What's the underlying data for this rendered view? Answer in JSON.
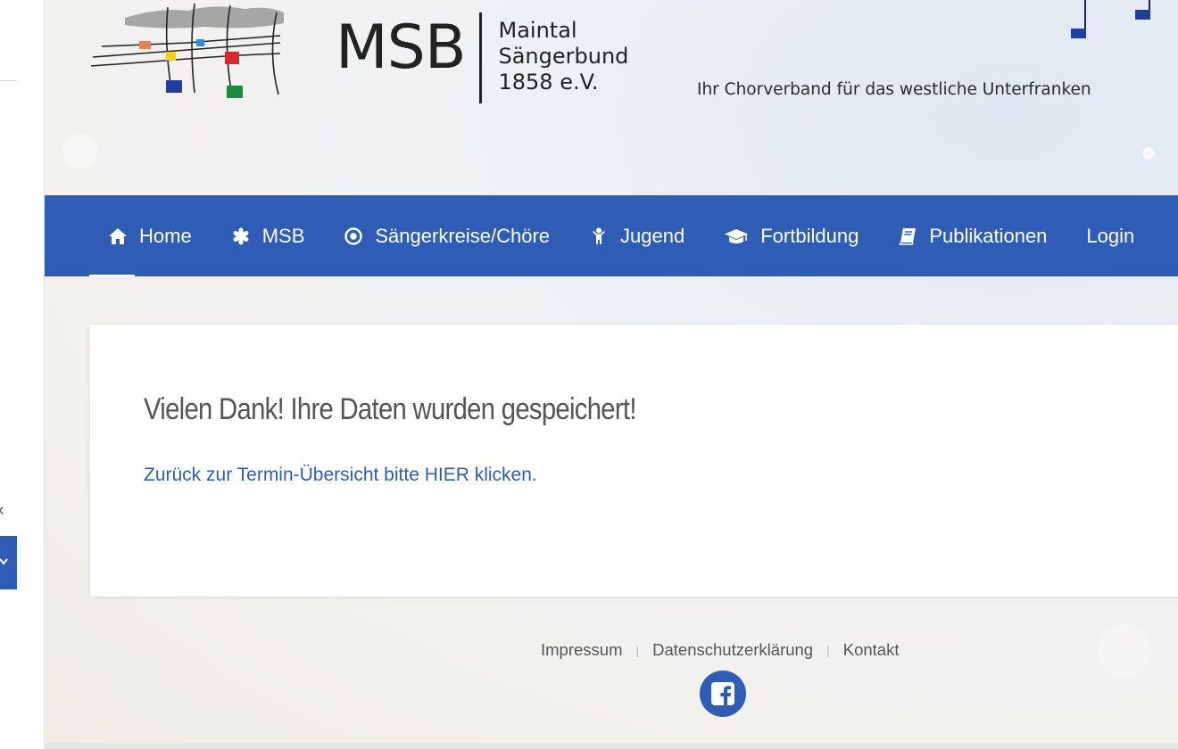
{
  "header": {
    "brand_abbr": "MSB",
    "brand_lines": [
      "Maintal",
      "Sängerbund",
      "1858 e.V."
    ],
    "tagline": "Ihr Chorverband für das westliche Unterfranken"
  },
  "nav": {
    "items": [
      {
        "label": "Home",
        "icon": "home-icon"
      },
      {
        "label": "MSB",
        "icon": "asterisk-icon"
      },
      {
        "label": "Sängerkreise/Chöre",
        "icon": "target-icon"
      },
      {
        "label": "Jugend",
        "icon": "child-icon"
      },
      {
        "label": "Fortbildung",
        "icon": "graduation-cap-icon"
      },
      {
        "label": "Publikationen",
        "icon": "book-icon"
      },
      {
        "label": "Login",
        "icon": ""
      }
    ]
  },
  "main": {
    "title": "Vielen Dank! Ihre Daten wurden gespeichert!",
    "link_text": "Zurück zur Termin-Übersicht bitte HIER klicken."
  },
  "footer": {
    "links": [
      "Impressum",
      "Datenschutzerklärung",
      "Kontakt"
    ],
    "social_icon": "facebook-icon"
  },
  "colors": {
    "accent": "#2f5cb4",
    "title_text": "#555555"
  }
}
